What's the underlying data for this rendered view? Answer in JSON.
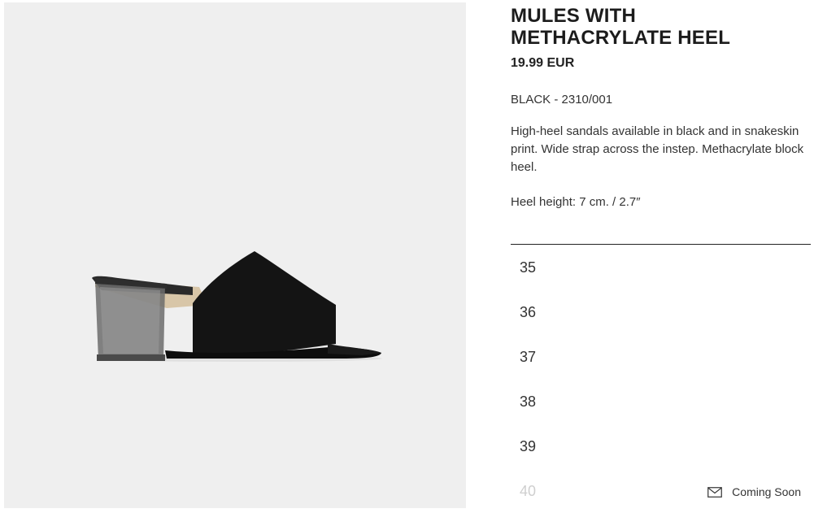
{
  "product": {
    "title": "MULES WITH METHACRYLATE HEEL",
    "price": "19.99 EUR",
    "color_ref": "BLACK - 2310/001",
    "description": "High-heel sandals available in black and in snakeskin print. Wide strap across the instep. Methacrylate block heel.",
    "heel_height": "Heel height: 7 cm. / 2.7″",
    "image_icon": "black-mule-shoe-image"
  },
  "sizes": [
    {
      "label": "35",
      "available": true
    },
    {
      "label": "36",
      "available": true
    },
    {
      "label": "37",
      "available": true
    },
    {
      "label": "38",
      "available": true
    },
    {
      "label": "39",
      "available": true
    },
    {
      "label": "40",
      "available": false,
      "status": "Coming Soon",
      "status_icon": "mail-icon"
    }
  ],
  "colors": {
    "image_background": "#efefef",
    "text": "#222222",
    "unavailable_text": "#cfcfcf"
  }
}
